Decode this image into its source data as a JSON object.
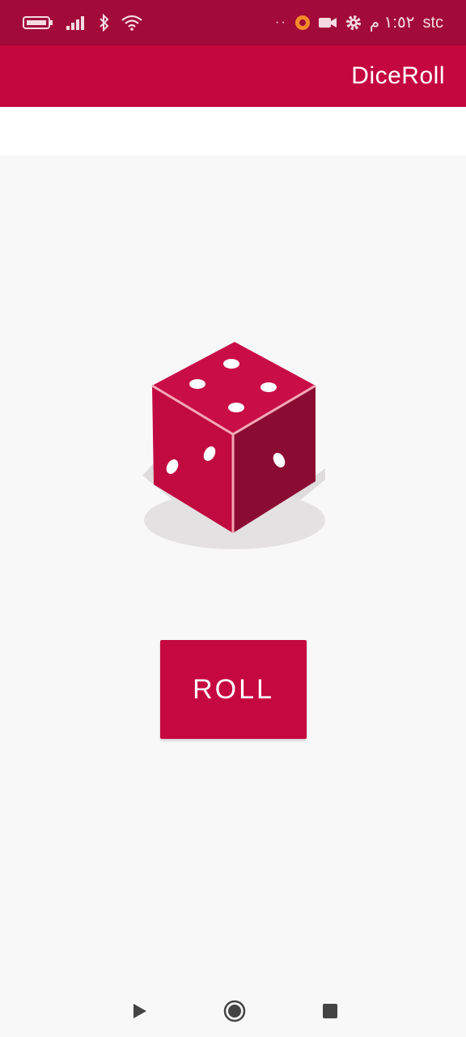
{
  "status_bar": {
    "carrier": "stc",
    "time": "١:٥٢ م",
    "overflow_indicator": "··",
    "icons": [
      "battery-icon",
      "signal-icon",
      "bluetooth-icon",
      "wifi-icon",
      "notification-icon",
      "video-camera-icon",
      "settings-icon"
    ],
    "colors": {
      "background": "#a20a3a",
      "foreground": "#f4dbe3"
    }
  },
  "app_bar": {
    "title": "DiceRoll",
    "colors": {
      "background": "#c4083f",
      "text": "#ffffff"
    }
  },
  "main": {
    "dice": {
      "icon": "dice-icon",
      "colors": {
        "top": "#c90e47",
        "left": "#c10a40",
        "right": "#8b0c33",
        "edge": "#f2a8b6",
        "pip": "#ffffff"
      }
    },
    "roll_button": {
      "label": "ROLL",
      "colors": {
        "background": "#c5083f",
        "text": "#ffffff"
      }
    }
  },
  "nav_bar": {
    "buttons": [
      "back-triangle-icon",
      "home-circle-icon",
      "recents-square-icon"
    ],
    "colors": {
      "icon": "#444444"
    }
  }
}
